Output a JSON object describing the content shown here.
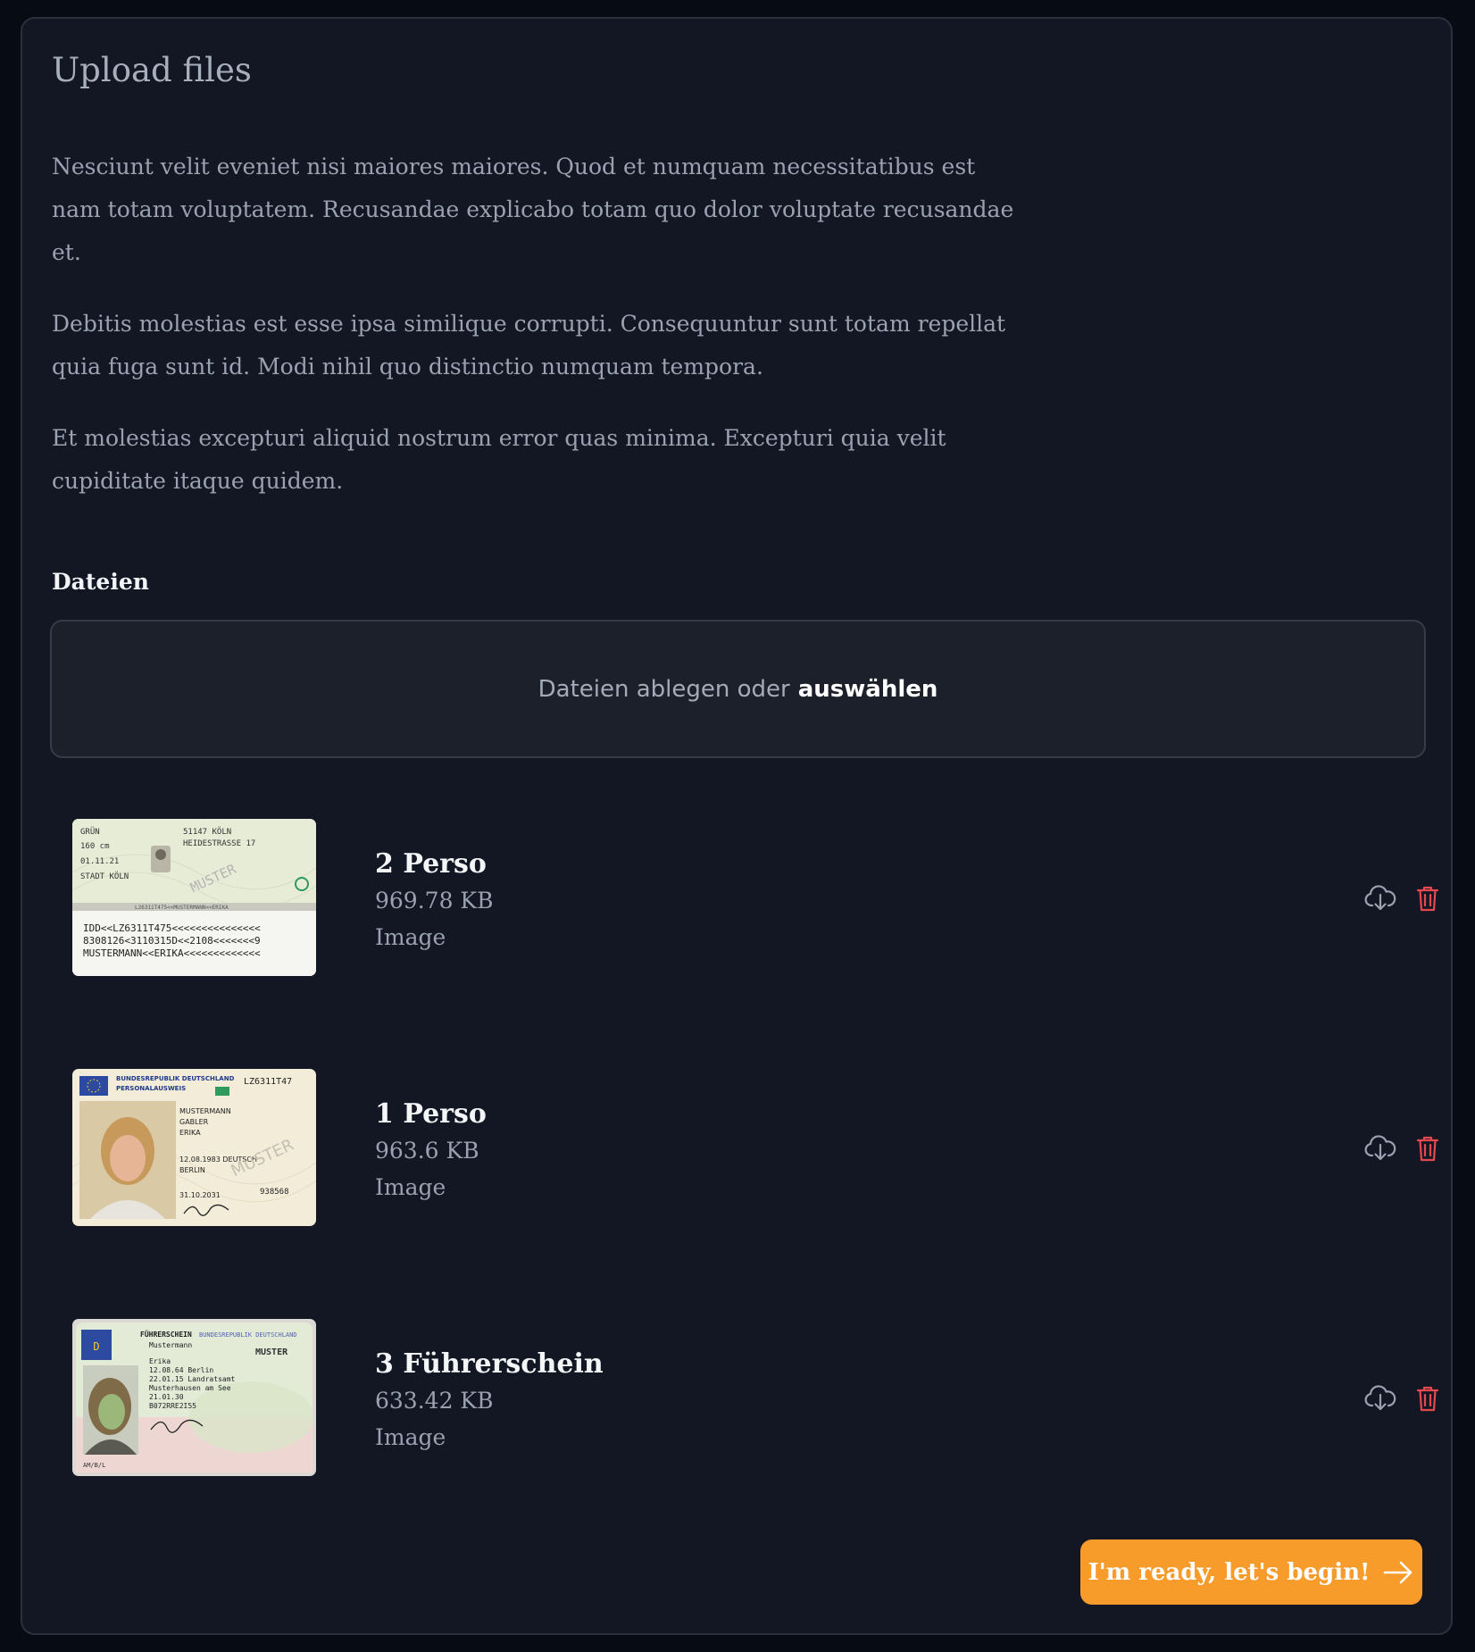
{
  "page": {
    "title": "Upload files",
    "paragraphs": [
      "Nesciunt velit eveniet nisi maiores maiores. Quod et numquam necessitatibus est nam totam voluptatem. Recusandae explicabo totam quo dolor voluptate recusandae et.",
      "Debitis molestias est esse ipsa similique corrupti. Consequuntur sunt totam repellat quia fuga sunt id. Modi nihil quo distinctio numquam tempora.",
      "Et molestias excepturi aliquid nostrum error quas minima. Excepturi quia velit cupiditate itaque quidem."
    ]
  },
  "files_section": {
    "label": "Dateien",
    "dropzone_text": "Dateien ablegen oder",
    "dropzone_link": "auswählen"
  },
  "files": [
    {
      "name": "2 Perso",
      "size": "969.78 KB",
      "type": "Image",
      "thumb": {
        "lines": [
          "GRÜN",
          "160 cm",
          "01.11.21",
          "STADT KÖLN",
          "51147 KÖLN",
          "HEIDESTRASSE 17",
          "MUSTER",
          "L26311T475<<MUSTERMANN<<ERIKA"
        ],
        "mrz": [
          "IDD<<LZ6311T475<<<<<<<<<<<<<<<",
          "8308126<3110315D<<2108<<<<<<<9",
          "MUSTERMANN<<ERIKA<<<<<<<<<<<<<"
        ]
      }
    },
    {
      "name": "1 Perso",
      "size": "963.6 KB",
      "type": "Image",
      "thumb": {
        "lines": [
          "BUNDESREPUBLIK DEUTSCHLAND",
          "PERSONALAUSWEIS",
          "LZ6311T47",
          "MUSTERMANN",
          "GABLER",
          "ERIKA",
          "12.08.1983 DEUTSCH",
          "BERLIN",
          "31.10.2031",
          "938568",
          "MUSTER"
        ]
      }
    },
    {
      "name": "3 Führerschein",
      "size": "633.42 KB",
      "type": "Image",
      "thumb": {
        "lines": [
          "FÜHRERSCHEIN",
          "BUNDESREPUBLIK DEUTSCHLAND",
          "Mustermann",
          "MUSTER",
          "Erika",
          "12.08.64 Berlin",
          "22.01.15 Landratsamt",
          "Musterhausen am See",
          "21.01.30",
          "B072RRE2I55",
          "AM/B/L"
        ]
      }
    }
  ],
  "cta": {
    "label": "I'm ready, let's begin!"
  },
  "colors": {
    "background": "#060b14",
    "card": "#121723",
    "accent": "#f79b2a",
    "danger": "#e5484d",
    "icon": "#9aa2b1"
  },
  "icons": {
    "download": "cloud-download-icon",
    "delete": "trash-icon",
    "arrow": "arrow-right-icon"
  }
}
